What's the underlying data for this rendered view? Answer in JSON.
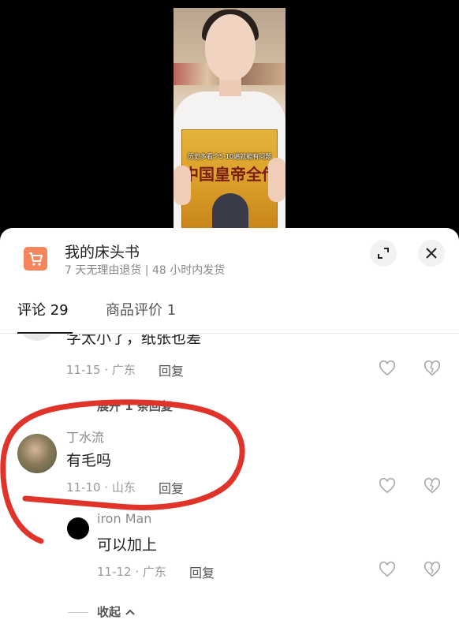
{
  "video": {
    "book_title": "中国皇帝全传",
    "subtitle": "历史多看个5-10遍就能有问题"
  },
  "shop": {
    "title": "我的床头书",
    "subtitle": "7 天无理由退货 | 48 小时内发货"
  },
  "tabs": {
    "comments": "评论 29",
    "reviews": "商品评价 1"
  },
  "comments": [
    {
      "text_partial": "字太小了，纸张也差",
      "meta": "11-15 · 广东",
      "reply": "回复",
      "expand": "展开 1 条回复"
    },
    {
      "username": "丁水流",
      "text": "有毛吗",
      "meta": "11-10 · 山东",
      "reply": "回复"
    }
  ],
  "replies": [
    {
      "username": "iron Man",
      "text": "可以加上",
      "meta": "11-12 · 广东",
      "reply": "回复"
    }
  ],
  "collapse": "收起",
  "colors": {
    "accent_orange": "#f5855a",
    "annotation_red": "#e0332a"
  },
  "icons": [
    "cart-icon",
    "expand-icon",
    "close-icon",
    "heart-icon",
    "broken-heart-icon",
    "chevron-down-icon",
    "chevron-up-icon"
  ]
}
